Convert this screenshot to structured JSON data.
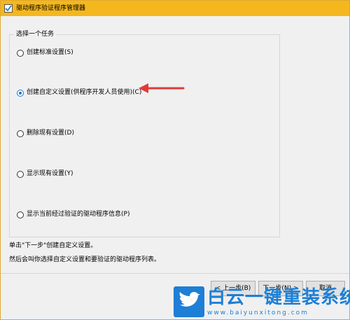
{
  "window": {
    "title": "驱动程序验证程序管理器",
    "icon": "checkmark-pen-icon"
  },
  "task_group": {
    "legend": "选择一个任务",
    "options": [
      {
        "label": "创建标准设置(S)",
        "checked": false
      },
      {
        "label": "创建自定义设置(供程序开发人员使用)(C)",
        "checked": true
      },
      {
        "label": "删除现有设置(D)",
        "checked": false
      },
      {
        "label": "显示现有设置(Y)",
        "checked": false
      },
      {
        "label": "显示当前经过验证的驱动程序信息(P)",
        "checked": false
      }
    ]
  },
  "info": {
    "line1": "单击\"下一步\"创建自定义设置。",
    "line2": "然后会叫你选择自定义设置和要验证的驱动程序列表。"
  },
  "buttons": {
    "back": "< 上一步(B)",
    "next": "下一步(N) >",
    "cancel": "取消"
  },
  "watermark": {
    "brand": "白云一键重装系统",
    "url": "www.baiyunxitong.com"
  },
  "colors": {
    "titlebar": "#f4b71e",
    "annotation_arrow": "#e03a3a",
    "watermark_blue": "#1d7fd6"
  }
}
